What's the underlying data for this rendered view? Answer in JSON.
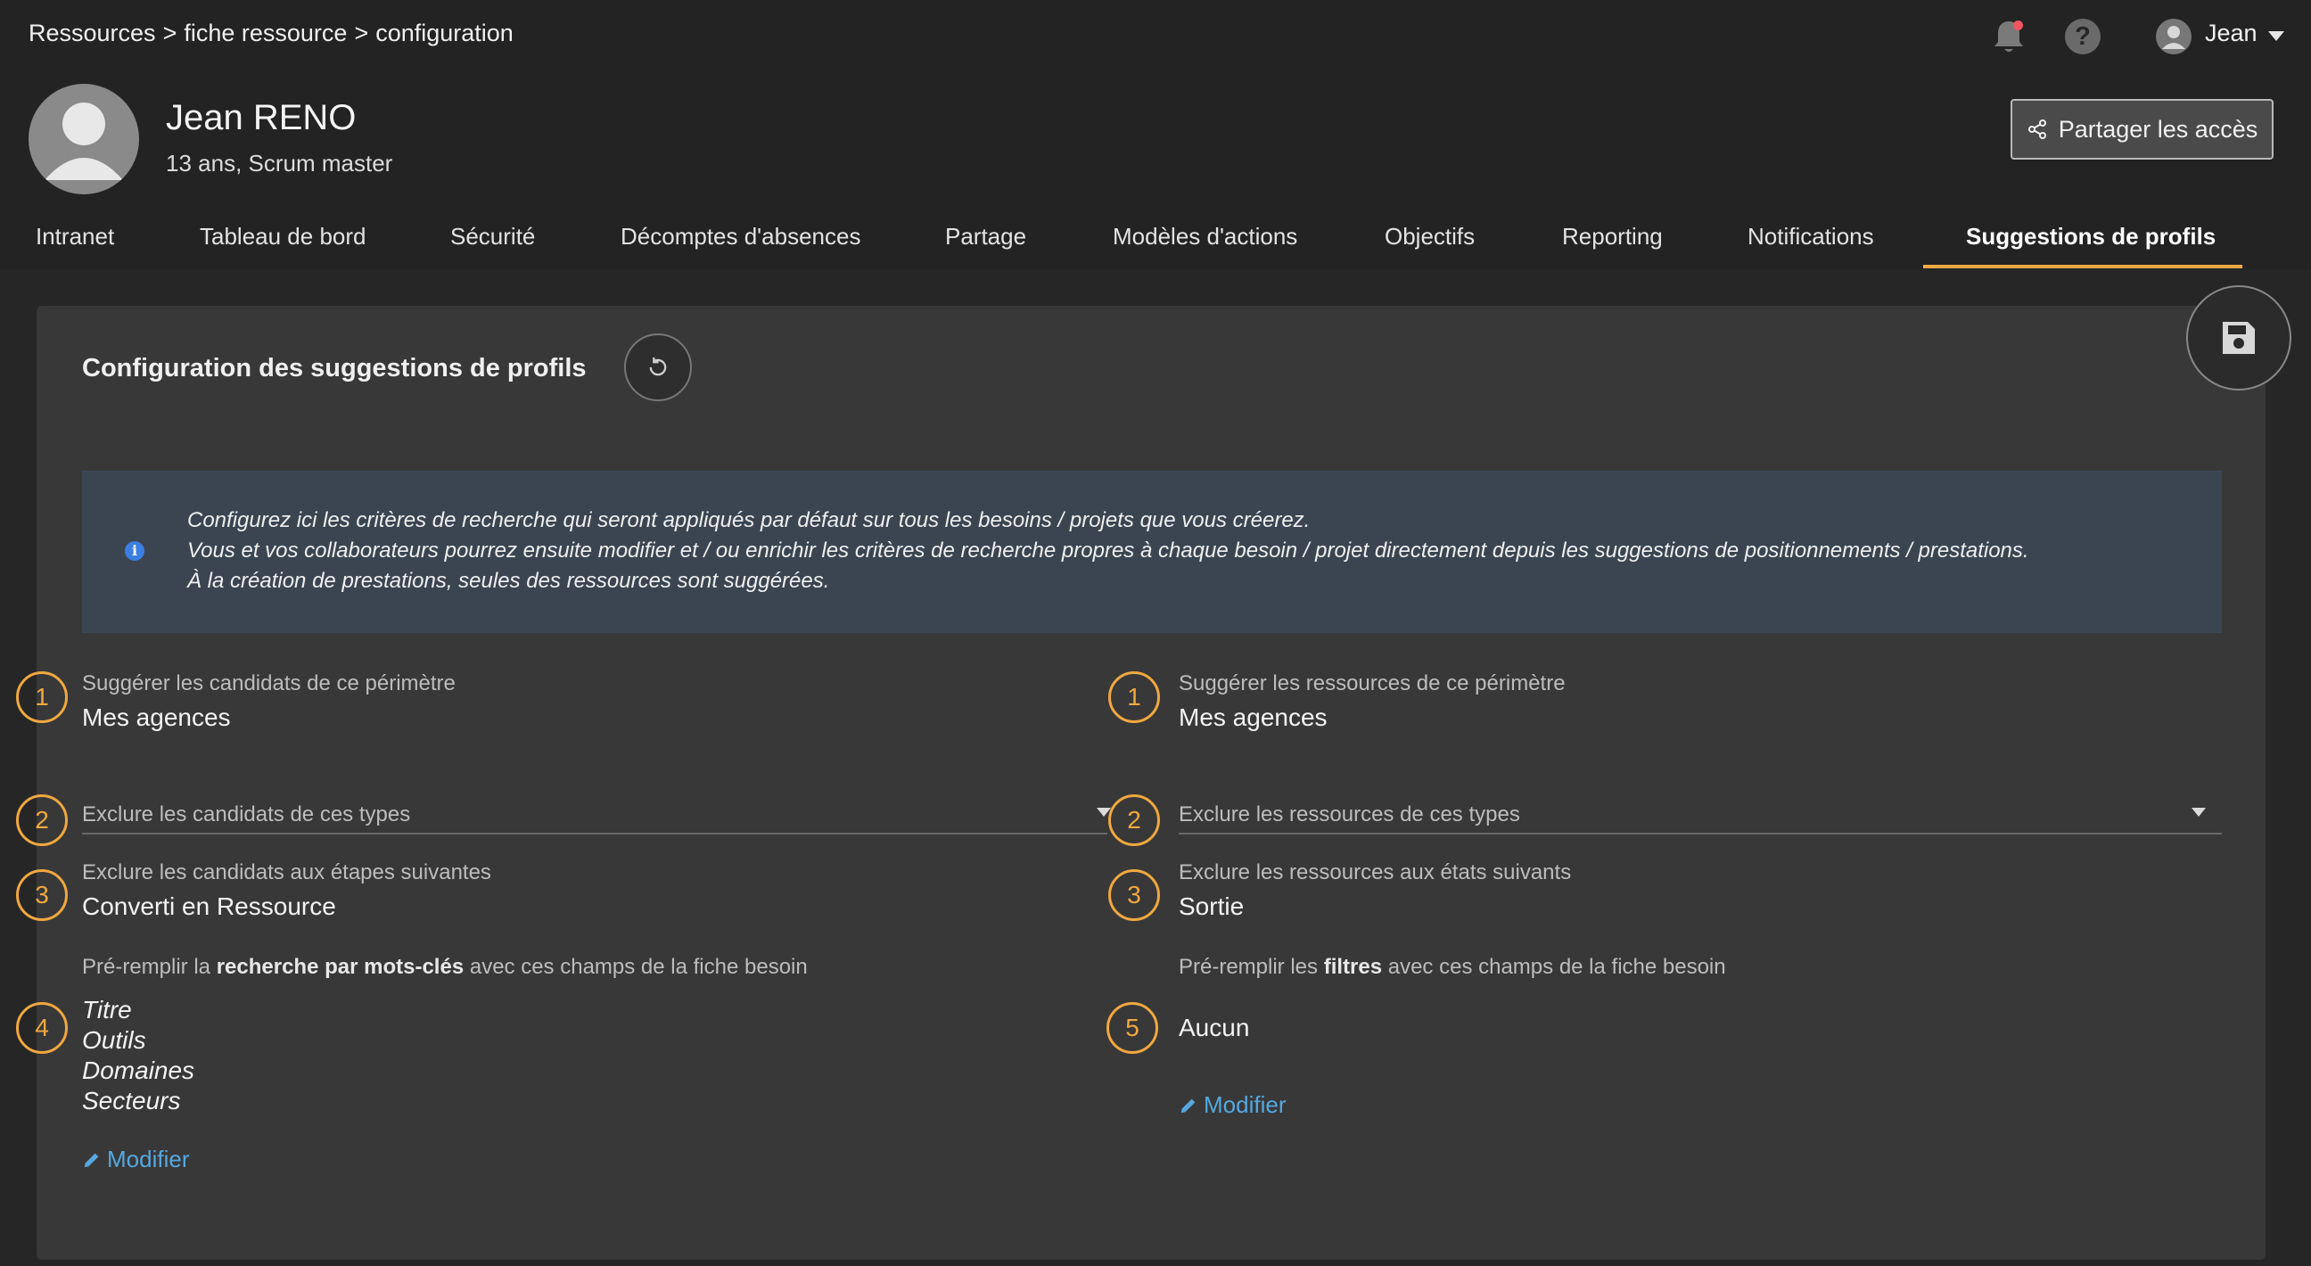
{
  "breadcrumb": {
    "items": [
      "Ressources",
      "fiche ressource",
      "configuration"
    ],
    "separator": ">"
  },
  "topbar": {
    "user_name": "Jean",
    "help_glyph": "?",
    "icons": [
      "bell-icon",
      "help-icon",
      "user-avatar-icon",
      "caret-down-icon"
    ]
  },
  "profile": {
    "name": "Jean RENO",
    "subtitle": "13 ans, Scrum master"
  },
  "share_button": {
    "label": "Partager les accès",
    "icon": "share-icon"
  },
  "tabs": [
    "Intranet",
    "Tableau de bord",
    "Sécurité",
    "Décomptes d'absences",
    "Partage",
    "Modèles d'actions",
    "Objectifs",
    "Reporting",
    "Notifications",
    "Suggestions de profils"
  ],
  "active_tab": "Suggestions de profils",
  "section": {
    "title": "Configuration des suggestions de profils"
  },
  "info": {
    "line1": "Configurez ici les critères de recherche qui seront appliqués par défaut sur tous les besoins / projets que vous créerez.",
    "line2": "Vous et vos collaborateurs pourrez ensuite modifier et / ou enrichir les critères de recherche propres à chaque besoin / projet directement depuis les suggestions de positionnements / prestations.",
    "line3": "À la création de prestations, seules des ressources sont suggérées."
  },
  "left": {
    "perimeter": {
      "num": "1",
      "label": "Suggérer les candidats de ce périmètre",
      "value": "Mes agences"
    },
    "exclude_types": {
      "num": "2",
      "label": "Exclure les candidats de ces types"
    },
    "exclude_steps": {
      "num": "3",
      "label": "Exclure les candidats aux étapes suivantes",
      "value": "Converti en Ressource"
    },
    "prefill": {
      "num": "4",
      "label_pre": "Pré-remplir la ",
      "label_bold": "recherche par mots-clés",
      "label_post": " avec ces champs de la fiche besoin",
      "values": [
        "Titre",
        "Outils",
        "Domaines",
        "Secteurs"
      ],
      "modify": "Modifier"
    }
  },
  "right": {
    "perimeter": {
      "num": "1",
      "label": "Suggérer les ressources de ce périmètre",
      "value": "Mes agences"
    },
    "exclude_types": {
      "num": "2",
      "label": "Exclure les ressources de ces types"
    },
    "exclude_states": {
      "num": "3",
      "label": "Exclure les ressources aux états suivants",
      "value": "Sortie"
    },
    "prefill": {
      "num": "5",
      "label_pre": "Pré-remplir les ",
      "label_bold": "filtres",
      "label_post": " avec ces champs de la fiche besoin",
      "value": "Aucun",
      "modify": "Modifier"
    }
  },
  "colors": {
    "accent": "#f0a840",
    "link": "#55a8e0",
    "info_bg": "#3b4552",
    "info_icon": "#3c7fe0",
    "notification_dot": "#ef5662"
  }
}
